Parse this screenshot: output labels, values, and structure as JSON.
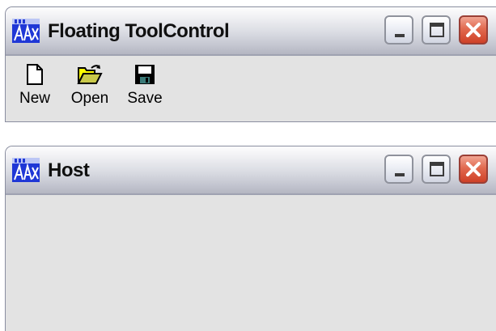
{
  "windows": {
    "floating_tool_control": {
      "title": "Floating ToolControl",
      "toolbar": [
        {
          "label": "New",
          "icon": "new-document-icon"
        },
        {
          "label": "Open",
          "icon": "open-folder-icon"
        },
        {
          "label": "Save",
          "icon": "floppy-disk-icon"
        }
      ]
    },
    "host": {
      "title": "Host"
    }
  },
  "colors": {
    "app_icon_blue": "#1f37d6",
    "close_button_red": "#e16a50",
    "window_background": "#e3e3e3"
  }
}
